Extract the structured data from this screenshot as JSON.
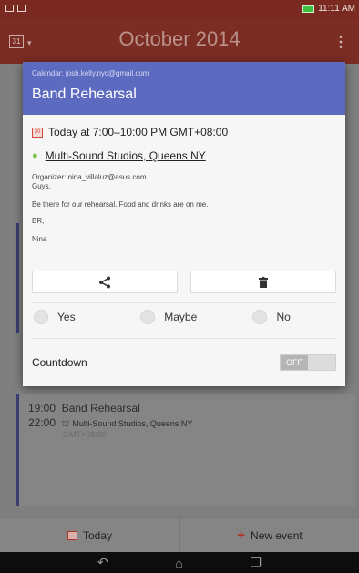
{
  "status_bar": {
    "time": "11:11 AM"
  },
  "app_bar": {
    "calendar_icon_text": "31",
    "month_title": "October 2014",
    "overflow": "⋮"
  },
  "background_event": {
    "start": "19:00",
    "end": "22:00",
    "title": "Band Rehearsal",
    "location": "Multi-Sound Studios, Queens NY",
    "timezone": "GMT+08:00"
  },
  "dialog": {
    "calendar": "Calendar: josh.kelly.nyc@gmail.com",
    "title": "Band Rehearsal",
    "date_icon_text": "30",
    "time": "Today at 7:00–10:00 PM  GMT+08:00",
    "location": "Multi-Sound Studios, Queens NY",
    "organizer": "Organizer: nina_villaluz@asus.com",
    "note_lines": [
      "Guys,",
      "Be there for our rehearsal. Food and drinks are on me.",
      "BR,",
      "Nina"
    ],
    "rsvp": [
      "Yes",
      "Maybe",
      "No"
    ],
    "countdown_label": "Countdown",
    "countdown_toggle": "OFF"
  },
  "bottom_bar": {
    "today": "Today",
    "new_event": "New event"
  },
  "colors": {
    "header": "#5c6bc0",
    "app_bar": "#7b2c23",
    "accent": "#b0332a"
  }
}
